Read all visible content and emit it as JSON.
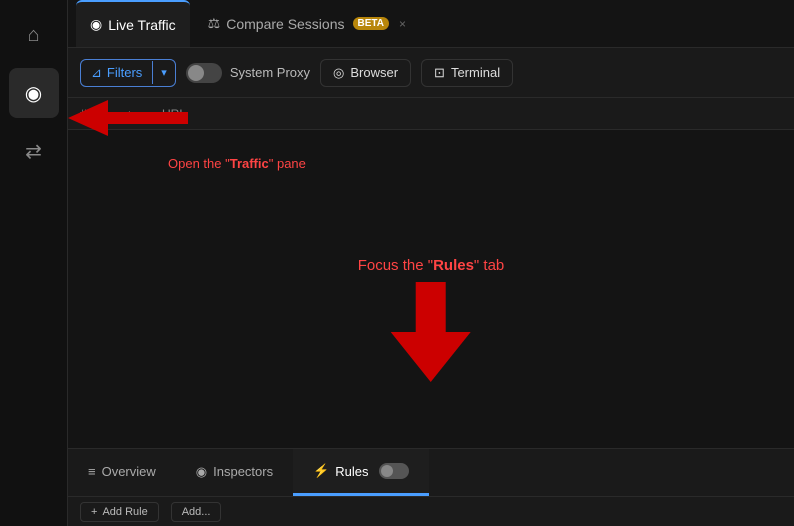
{
  "sidebar": {
    "items": [
      {
        "id": "home",
        "icon": "⌂",
        "label": "Home",
        "active": false
      },
      {
        "id": "traffic",
        "icon": "◉",
        "label": "Traffic",
        "active": true
      },
      {
        "id": "replay",
        "icon": "⇄",
        "label": "Replay",
        "active": false
      }
    ]
  },
  "tabs": {
    "live_traffic": {
      "label": "Live Traffic",
      "icon": "◉",
      "active": true
    },
    "compare_sessions": {
      "label": "Compare Sessions",
      "icon": "⚖",
      "active": false,
      "badge": "BETA"
    },
    "close_icon": "×"
  },
  "toolbar": {
    "filter_label": "Filters",
    "filter_icon": "⊿",
    "dropdown_icon": "▾",
    "system_proxy_label": "System Proxy",
    "browser_label": "Browser",
    "browser_icon": "◎",
    "terminal_label": "Terminal",
    "terminal_icon": "⊡"
  },
  "annotation_tooltip": {
    "prefix": "Open the \"",
    "bold": "Traffic",
    "suffix": "\" pane"
  },
  "table_header": {
    "hash": "#",
    "arrow": "↑",
    "url": "URL"
  },
  "annotation_focus": {
    "prefix": "Focus the \"",
    "bold": "Rules",
    "suffix": "\" tab"
  },
  "bottom_tabs": [
    {
      "id": "overview",
      "label": "Overview",
      "icon": "≡",
      "active": false
    },
    {
      "id": "inspectors",
      "label": "Inspectors",
      "icon": "◉",
      "active": false
    },
    {
      "id": "rules",
      "label": "Rules",
      "icon": "⚡",
      "active": true,
      "has_toggle": true
    }
  ],
  "footer": {
    "add_rule_label": "Add Rule",
    "add_label": "Add..."
  }
}
